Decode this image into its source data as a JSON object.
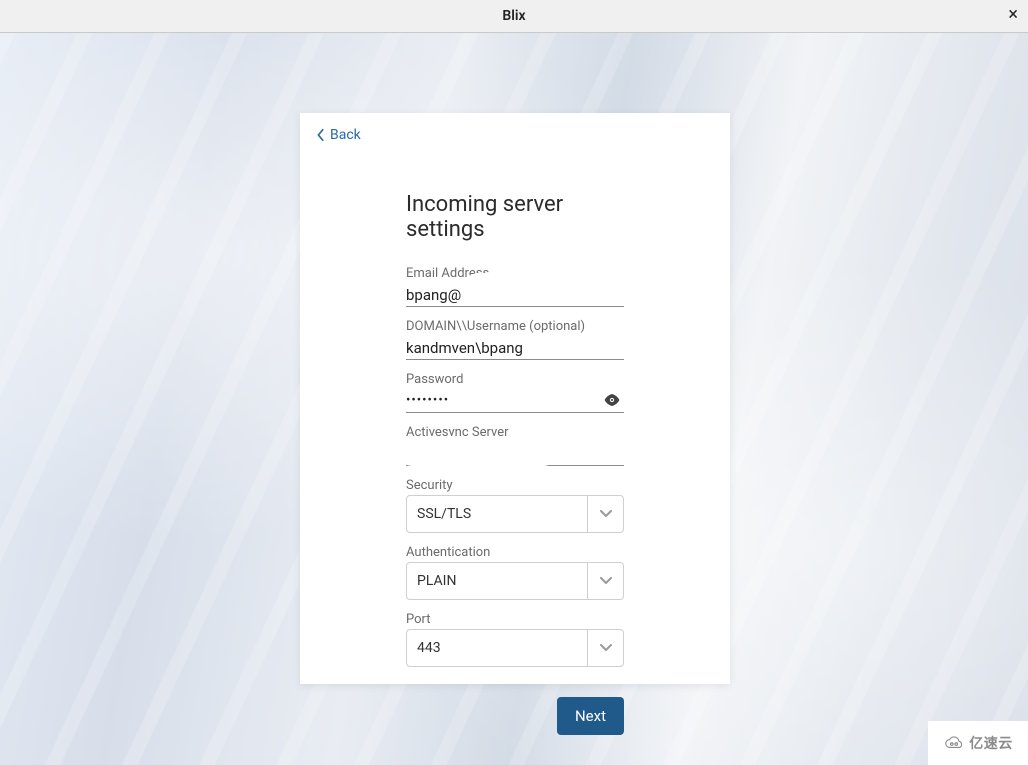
{
  "window": {
    "title": "Blix",
    "close_glyph": "×"
  },
  "card": {
    "back_label": "Back",
    "heading": "Incoming server settings",
    "next_label": "Next"
  },
  "fields": {
    "email": {
      "label": "Email Address",
      "value": "bpang@"
    },
    "domain_user": {
      "label": "DOMAIN\\\\Username (optional)",
      "value": "kandmven\\bpang"
    },
    "password": {
      "label": "Password",
      "value_masked": "••••••••"
    },
    "activesync": {
      "label": "Activesync Server",
      "value": ""
    },
    "security": {
      "label": "Security",
      "selected": "SSL/TLS"
    },
    "authentication": {
      "label": "Authentication",
      "selected": "PLAIN"
    },
    "port": {
      "label": "Port",
      "selected": "443"
    }
  },
  "watermark": {
    "text": "亿速云"
  },
  "colors": {
    "accent": "#1f5a8a",
    "link": "#2a6aa8"
  }
}
